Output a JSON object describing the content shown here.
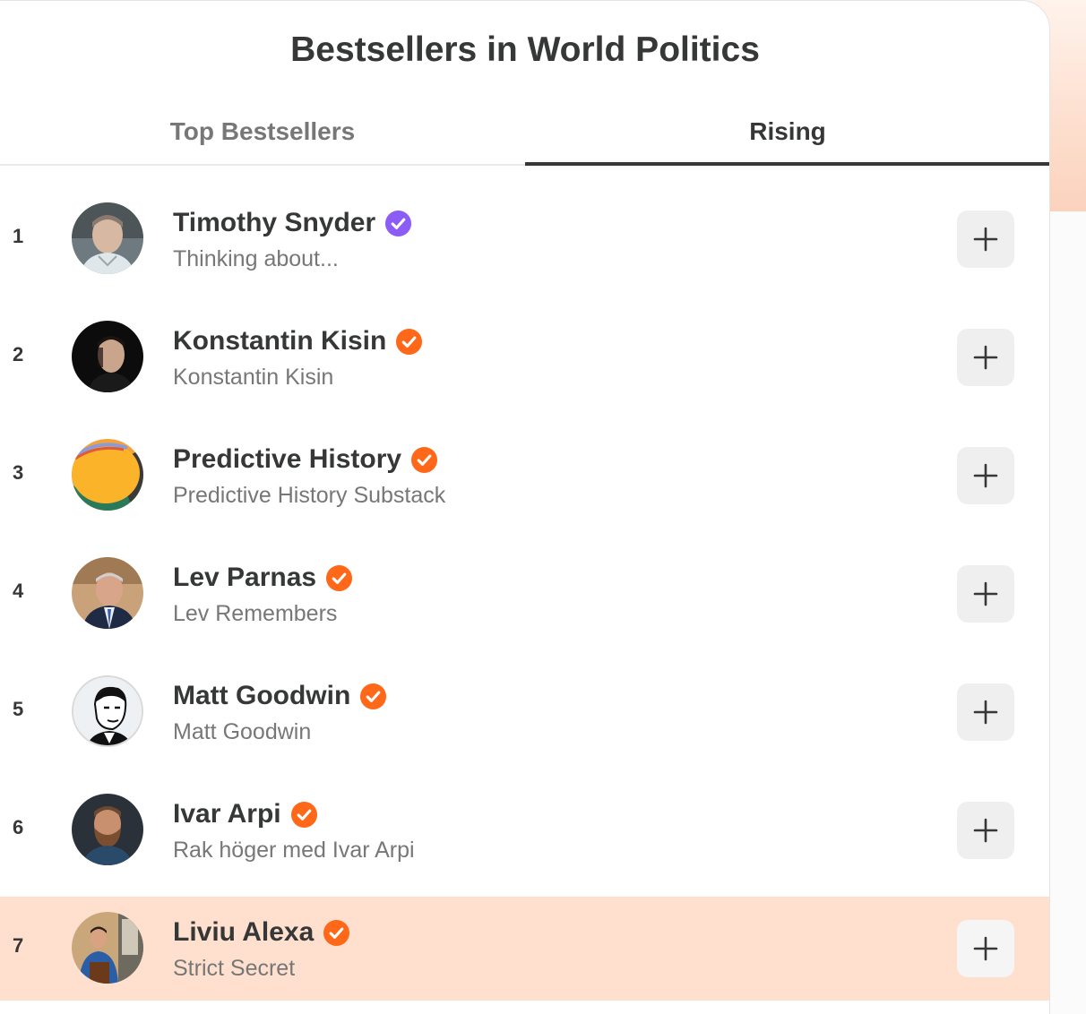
{
  "header": {
    "title": "Bestsellers in World Politics"
  },
  "tabs": [
    {
      "label": "Top Bestsellers",
      "active": false
    },
    {
      "label": "Rising",
      "active": true
    }
  ],
  "entries": [
    {
      "rank": "1",
      "name": "Timothy Snyder",
      "subtitle": "Thinking about...",
      "badge": "purple-check-badge",
      "badge_color": "#8b5cf6"
    },
    {
      "rank": "2",
      "name": "Konstantin Kisin",
      "subtitle": "Konstantin Kisin",
      "badge": "orange-check-badge",
      "badge_color": "#ff6719"
    },
    {
      "rank": "3",
      "name": "Predictive History",
      "subtitle": "Predictive History Substack",
      "badge": "orange-check-badge",
      "badge_color": "#ff6719"
    },
    {
      "rank": "4",
      "name": "Lev Parnas",
      "subtitle": "Lev Remembers",
      "badge": "orange-check-badge",
      "badge_color": "#ff6719"
    },
    {
      "rank": "5",
      "name": "Matt Goodwin",
      "subtitle": "Matt Goodwin",
      "badge": "orange-check-badge",
      "badge_color": "#ff6719"
    },
    {
      "rank": "6",
      "name": "Ivar Arpi",
      "subtitle": "Rak höger med Ivar Arpi",
      "badge": "orange-check-badge",
      "badge_color": "#ff6719"
    },
    {
      "rank": "7",
      "name": "Liviu Alexa",
      "subtitle": "Strict Secret",
      "badge": "orange-check-badge",
      "badge_color": "#ff6719",
      "highlighted": true
    }
  ],
  "icons": {
    "follow": "plus-icon",
    "verified": "check-badge-icon"
  },
  "colors": {
    "highlight_row": "#ffe0cf",
    "accent_orange": "#ff6719",
    "accent_purple": "#8b5cf6",
    "active_tab_underline": "#363737"
  }
}
